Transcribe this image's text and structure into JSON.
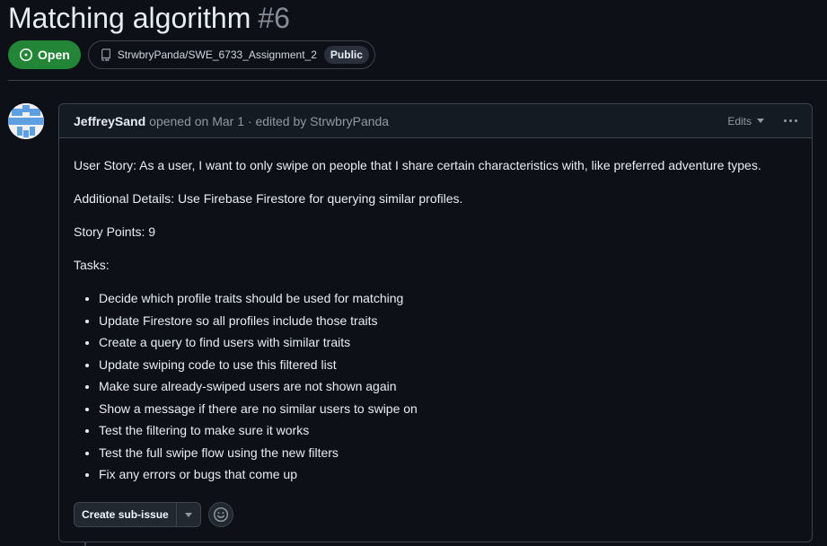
{
  "issue": {
    "title": "Matching algorithm",
    "number": "#6",
    "state": "Open",
    "repo": "StrwbryPanda/SWE_6733_Assignment_2",
    "visibility": "Public"
  },
  "comment": {
    "author": "JeffreySand",
    "meta": "opened on Mar 1 · edited by StrwbryPanda",
    "edits_label": "Edits",
    "paragraphs": [
      "User Story: As a user, I want to only swipe on people that I share certain characteristics with, like preferred adventure types.",
      "Additional Details: Use Firebase Firestore for querying similar profiles.",
      "Story Points: 9",
      "Tasks:"
    ],
    "tasks": [
      "Decide which profile traits should be used for matching",
      "Update Firestore so all profiles include those traits",
      "Create a query to find users with similar traits",
      "Update swiping code to use this filtered list",
      "Make sure already-swiped users are not shown again",
      "Show a message if there are no similar users to swipe on",
      "Test the filtering to make sure it works",
      "Test the full swipe flow using the new filters",
      "Fix any errors or bugs that come up"
    ],
    "create_subissue_label": "Create sub-issue"
  },
  "icons": {
    "state": "issue-opened-icon",
    "repo": "repo-icon",
    "menu": "kebab-horizontal-icon",
    "caret": "triangle-down-icon",
    "reaction": "smiley-icon",
    "avatar": "identicon-avatar"
  },
  "colors": {
    "background": "#0d1117",
    "open_green": "#238636",
    "border": "#3d444d",
    "muted_text": "#9198a1",
    "avatar_blue": "#5d9fe0"
  }
}
